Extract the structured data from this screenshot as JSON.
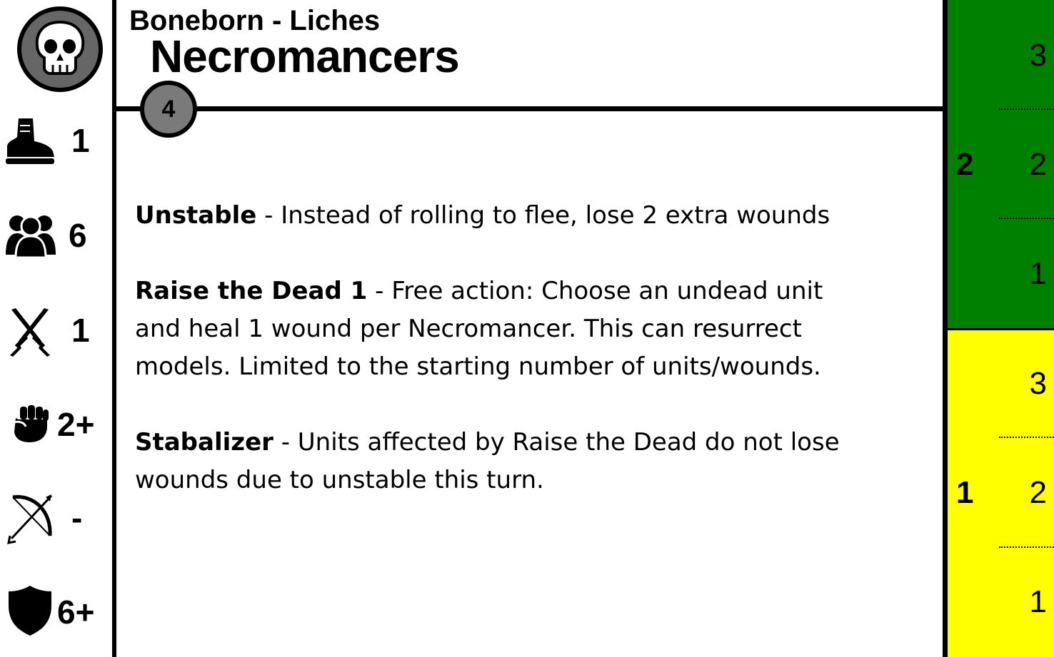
{
  "header": {
    "subtitle": "Boneborn - Liches",
    "title": "Necromancers",
    "cost": "4"
  },
  "faction_icon": "skull-icon",
  "stats": [
    {
      "icon": "boot-icon",
      "value": "1"
    },
    {
      "icon": "group-icon",
      "value": "6"
    },
    {
      "icon": "crossed-swords-icon",
      "value": "1"
    },
    {
      "icon": "fist-icon",
      "value": "2+"
    },
    {
      "icon": "bow-icon",
      "value": "-"
    },
    {
      "icon": "shield-icon",
      "value": "6+"
    }
  ],
  "rules": [
    {
      "name": "Unstable",
      "text": " - Instead of rolling to flee, lose 2 extra wounds"
    },
    {
      "name": "Raise the Dead 1",
      "text": " - Free action: Choose an undead unit and heal 1 wound per Necromancer. This can resurrect models. Limited to the starting number of units/wounds."
    },
    {
      "name": "Stabalizer",
      "text": " - Units affected by Raise the Dead do not lose wounds due to unstable this turn."
    }
  ],
  "track": {
    "colors": {
      "green": "#008000",
      "yellow": "#ffff00"
    },
    "bands": [
      {
        "color": "green",
        "level": "2",
        "wounds": [
          "3",
          "2",
          "1"
        ]
      },
      {
        "color": "yellow",
        "level": "1",
        "wounds": [
          "3",
          "2",
          "1"
        ]
      }
    ]
  }
}
